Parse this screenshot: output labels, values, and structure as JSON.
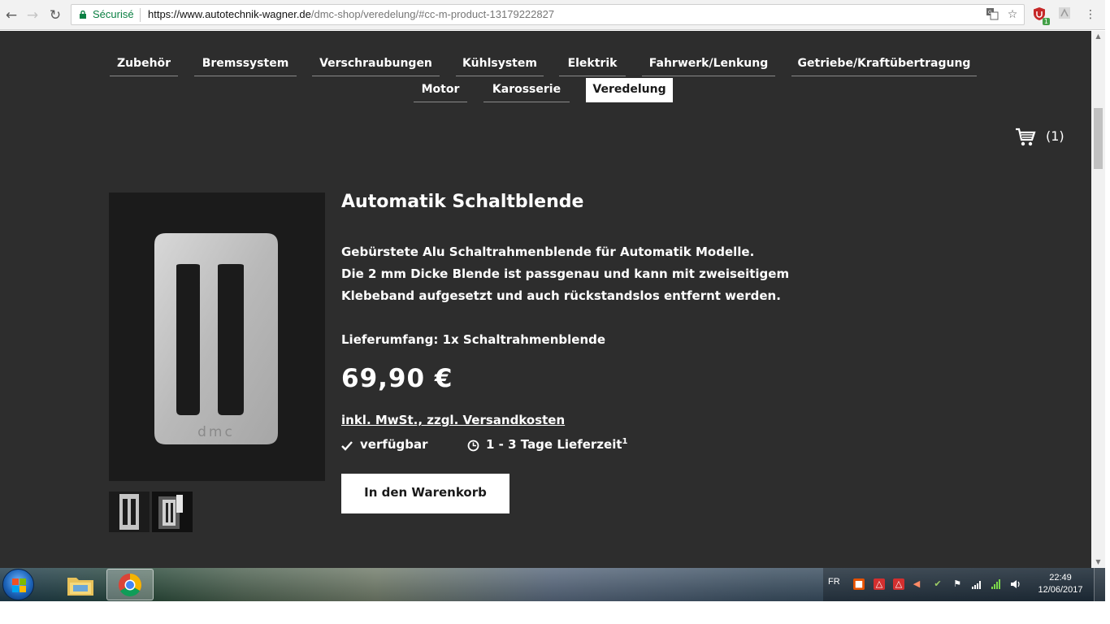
{
  "browser": {
    "security_label": "Sécurisé",
    "url_host": "https://www.autotechnik-wagner.de",
    "url_path": "/dmc-shop/veredelung/#cc-m-product-13179222827",
    "extension_badge": "1"
  },
  "nav": {
    "items": [
      {
        "label": "Zubehör",
        "active": false
      },
      {
        "label": "Bremssystem",
        "active": false
      },
      {
        "label": "Verschraubungen",
        "active": false
      },
      {
        "label": "Kühlsystem",
        "active": false
      },
      {
        "label": "Elektrik",
        "active": false
      },
      {
        "label": "Fahrwerk/Lenkung",
        "active": false
      },
      {
        "label": "Getriebe/Kraftübertragung",
        "active": false
      },
      {
        "label": "Motor",
        "active": false
      },
      {
        "label": "Karosserie",
        "active": false
      },
      {
        "label": "Veredelung",
        "active": true
      }
    ]
  },
  "cart": {
    "count_label": "(1)"
  },
  "product": {
    "title": "Automatik Schaltblende",
    "description_lines": [
      "Gebürstete Alu Schaltrahmenblende für Automatik Modelle.",
      "Die 2 mm Dicke Blende ist passgenau und kann mit zweiseitigem",
      "Klebeband aufgesetzt und auch rückstandslos entfernt werden."
    ],
    "scope": "Lieferumfang: 1x Schaltrahmenblende",
    "price": "69,90 €",
    "tax_note": "inkl. MwSt., zzgl. Versandkosten",
    "availability": "verfügbar",
    "delivery_time": "1 - 3 Tage Lieferzeit",
    "delivery_footnote": "1",
    "add_to_cart_label": "In den Warenkorb",
    "logo_text": "dmc"
  },
  "taskbar": {
    "language": "FR",
    "time": "22:49",
    "date": "12/06/2017"
  },
  "colors": {
    "page_background": "#2d2d2d",
    "secure_green": "#0b8043",
    "active_tab_bg": "#ffffff"
  }
}
